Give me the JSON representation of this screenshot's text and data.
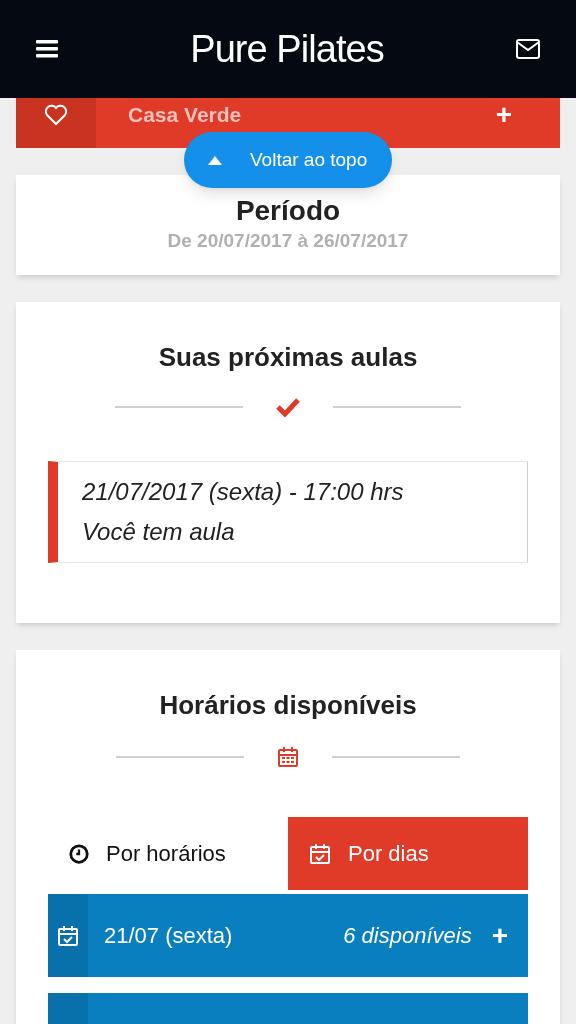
{
  "header": {
    "logo": "Pure Pilates"
  },
  "studio": {
    "name": "Casa Verde",
    "expand": "+"
  },
  "back_to_top": {
    "label": "Voltar ao topo"
  },
  "period": {
    "title": "Período",
    "range": "De 20/07/2017 à 26/07/2017"
  },
  "upcoming": {
    "title": "Suas próximas aulas",
    "items": [
      {
        "when": "21/07/2017 (sexta) - 17:00 hrs",
        "note": "Você tem aula"
      }
    ]
  },
  "available": {
    "title": "Horários disponíveis",
    "tabs": [
      {
        "label": "Por horários",
        "kind": "clock",
        "selected": false
      },
      {
        "label": "Por dias",
        "kind": "calendar",
        "selected": true
      }
    ],
    "days": [
      {
        "date": "21/07 (sexta)",
        "count": "6 disponíveis",
        "expand": "+"
      }
    ]
  }
}
